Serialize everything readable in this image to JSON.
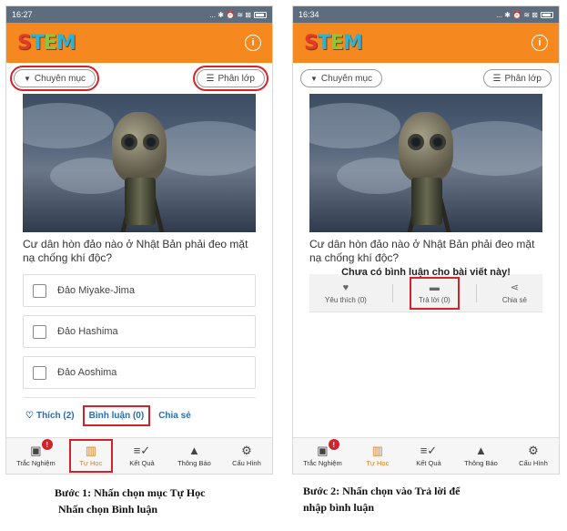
{
  "colors": {
    "appbar": "#f5891f",
    "highlight": "#d3232a",
    "link": "#2b6cb0",
    "active_tab": "#e07f1a"
  },
  "logo": {
    "letters": [
      "S",
      "T",
      "E",
      "M"
    ],
    "colors": [
      "#e23b2e",
      "#2bb3d6",
      "#8cc63f",
      "#2bb3d6"
    ]
  },
  "screen1": {
    "status": {
      "time": "16:27",
      "icons": "... ✱ ⏰ ≋ ⊠"
    },
    "filters": {
      "category": "Chuyên mục",
      "class": "Phân lớp"
    },
    "question": "Cư dân hòn đảo nào ở Nhật Bản phải đeo mặt nạ chống khí độc?",
    "options": [
      "Đảo Miyake-Jima",
      "Đảo Hashima",
      "Đảo Aoshima"
    ],
    "actions": {
      "like": "Thích (2)",
      "comment": "Bình luận (0)",
      "share": "Chia sẻ"
    },
    "caption_line1": "Bước 1: Nhấn chọn mục Tự Học",
    "caption_line2": "Nhấn chọn Bình luận"
  },
  "screen2": {
    "status": {
      "time": "16:34",
      "icons": "... ✱ ⏰ ≋ ⊠"
    },
    "filters": {
      "category": "Chuyên mục",
      "class": "Phân lớp"
    },
    "question": "Cư dân hòn đảo nào ở Nhật Bản phải đeo mặt nạ chống khí độc?",
    "actions": {
      "like": "Yêu thích (0)",
      "reply": "Trả lời (0)",
      "share": "Chia sẻ"
    },
    "empty_message": "Chưa có bình luận cho bài viết này!",
    "caption_line1": "Bước 2: Nhấn chọn vào Trả lời để",
    "caption_line2": "nhập bình luận"
  },
  "tabs": [
    {
      "label": "Trắc Nghiệm",
      "icon": "quiz-icon",
      "glyph": "▣",
      "badge": "!"
    },
    {
      "label": "Tự Học",
      "icon": "book-icon",
      "glyph": "📖"
    },
    {
      "label": "Kết Quả",
      "icon": "results-icon",
      "glyph": "≡✓"
    },
    {
      "label": "Thông Báo",
      "icon": "bell-icon",
      "glyph": "🔔"
    },
    {
      "label": "Cấu Hình",
      "icon": "gear-icon",
      "glyph": "⚙"
    }
  ],
  "info_glyph": "i"
}
